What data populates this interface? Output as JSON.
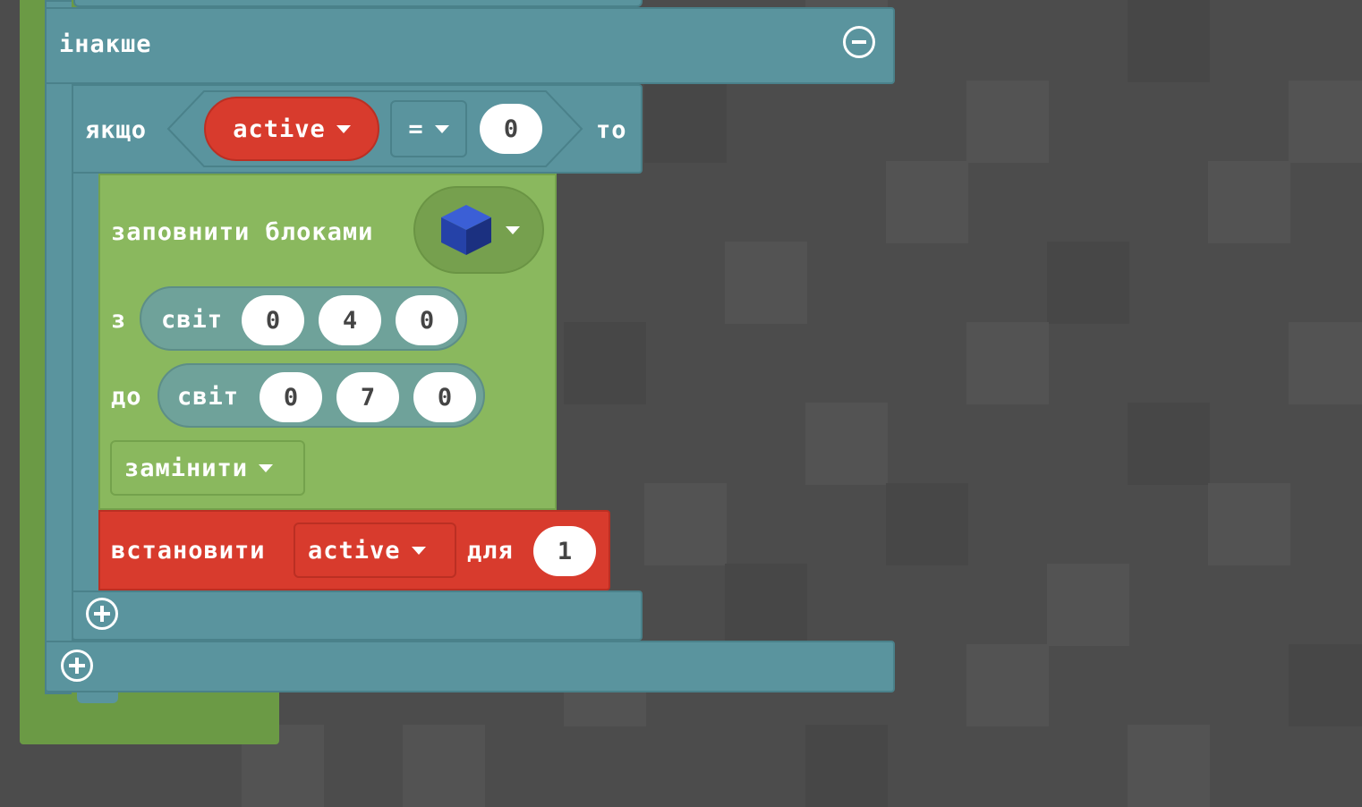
{
  "blocks": {
    "else_label": "інакше",
    "if_label": "якщо",
    "then_label": "то",
    "condition": {
      "variable": "active",
      "operator": "=",
      "value": "0"
    },
    "fill": {
      "label": "заповнити блоками",
      "block_item": "blue-cube-icon",
      "from_label": "з",
      "to_label": "до",
      "world_label": "світ",
      "from_coords": [
        "0",
        "4",
        "0"
      ],
      "to_coords": [
        "0",
        "7",
        "0"
      ],
      "mode": "замінити"
    },
    "set": {
      "label": "встановити",
      "variable": "active",
      "for_label": "для",
      "value": "1"
    }
  },
  "colors": {
    "workspace": "#4c4c4c",
    "logic_teal": "#5a949e",
    "blocks_green": "#8ab85e",
    "variables_red": "#d83b2d",
    "loops_green": "#6b9a45"
  }
}
